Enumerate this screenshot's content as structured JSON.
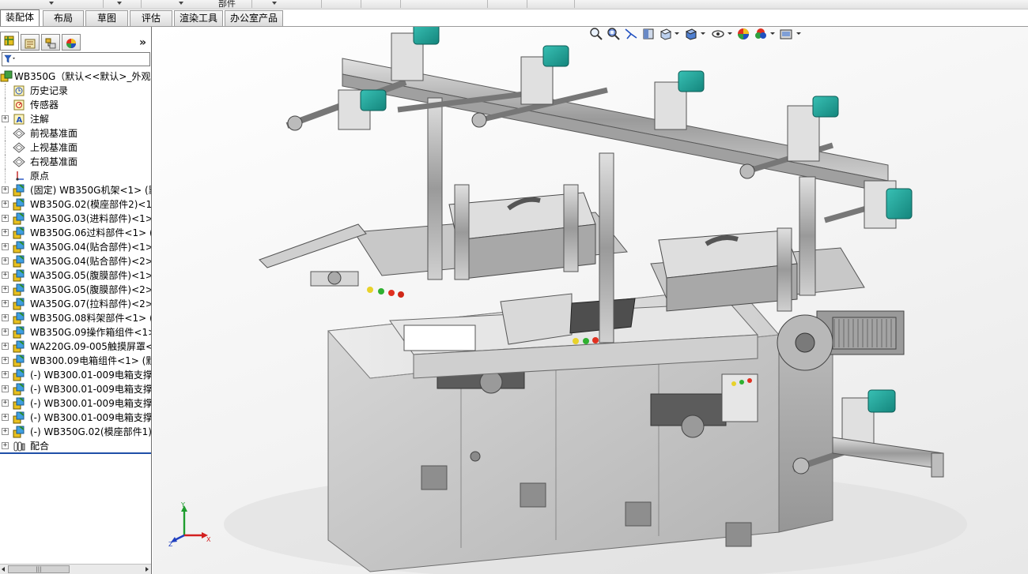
{
  "ribbon": {
    "partial_label": "部件"
  },
  "tabs": [
    {
      "label": "装配体",
      "active": true
    },
    {
      "label": "布局",
      "active": false
    },
    {
      "label": "草图",
      "active": false
    },
    {
      "label": "评估",
      "active": false
    },
    {
      "label": "渲染工具",
      "active": false
    },
    {
      "label": "办公室产品",
      "active": false
    }
  ],
  "pane": {
    "tabs": [
      "featuremanager-tree-icon",
      "property-manager-icon",
      "configuration-manager-icon",
      "display-manager-icon"
    ],
    "expand_glyph": "»"
  },
  "tree": {
    "root": "WB350G（默认<<默认>_外观 ...",
    "items": [
      {
        "label": "历史记录",
        "icon": "history-icon"
      },
      {
        "label": "传感器",
        "icon": "sensor-icon"
      },
      {
        "label": "注解",
        "icon": "annotation-icon"
      },
      {
        "label": "前视基准面",
        "icon": "plane-icon"
      },
      {
        "label": "上视基准面",
        "icon": "plane-icon"
      },
      {
        "label": "右视基准面",
        "icon": "plane-icon"
      },
      {
        "label": "原点",
        "icon": "origin-icon"
      },
      {
        "label": "(固定) WB350G机架<1> (默",
        "icon": "subassembly-icon"
      },
      {
        "label": "WB350G.02(模座部件2)<1>",
        "icon": "subassembly-icon"
      },
      {
        "label": "WA350G.03(进料部件)<1>",
        "icon": "subassembly-icon"
      },
      {
        "label": "WB350G.06过料部件<1> (默",
        "icon": "subassembly-icon"
      },
      {
        "label": "WA350G.04(贴合部件)<1>",
        "icon": "subassembly-icon"
      },
      {
        "label": "WA350G.04(贴合部件)<2>",
        "icon": "subassembly-icon"
      },
      {
        "label": "WA350G.05(腹膜部件)<1>",
        "icon": "subassembly-icon"
      },
      {
        "label": "WA350G.05(腹膜部件)<2>",
        "icon": "subassembly-icon"
      },
      {
        "label": "WA350G.07(拉料部件)<2>",
        "icon": "subassembly-icon"
      },
      {
        "label": "WB350G.08料架部件<1> (默",
        "icon": "subassembly-icon"
      },
      {
        "label": "WB350G.09操作箱组件<1>",
        "icon": "subassembly-icon"
      },
      {
        "label": "WA220G.09-005触摸屏罩<1",
        "icon": "subassembly-icon"
      },
      {
        "label": "WB300.09电箱组件<1> (默认",
        "icon": "subassembly-icon"
      },
      {
        "label": "(-) WB300.01-009电箱支撑柱",
        "icon": "subassembly-icon"
      },
      {
        "label": "(-) WB300.01-009电箱支撑柱",
        "icon": "subassembly-icon"
      },
      {
        "label": "(-) WB300.01-009电箱支撑柱",
        "icon": "subassembly-icon"
      },
      {
        "label": "(-) WB300.01-009电箱支撑柱",
        "icon": "subassembly-icon"
      },
      {
        "label": "(-) WB350G.02(模座部件1)<",
        "icon": "subassembly-icon"
      },
      {
        "label": "配合",
        "icon": "mates-icon"
      }
    ]
  },
  "scrollbar": {
    "thumb_glyph": "|||"
  },
  "view_toolbar": {
    "buttons": [
      "zoom-to-fit-icon",
      "zoom-to-area-icon",
      "previous-view-icon",
      "section-view-icon",
      "view-orientation-icon",
      "display-style-icon",
      "hide-show-items-icon",
      "edit-appearance-icon",
      "apply-scene-icon",
      "view-settings-icon"
    ]
  },
  "triad": {
    "x_label": "X",
    "y_label": "Y",
    "z_label": "Z"
  },
  "colors": {
    "accent": "#1f4fa8",
    "motor_teal": "#1fa39a",
    "machine_gray": "#c9c9c9"
  }
}
